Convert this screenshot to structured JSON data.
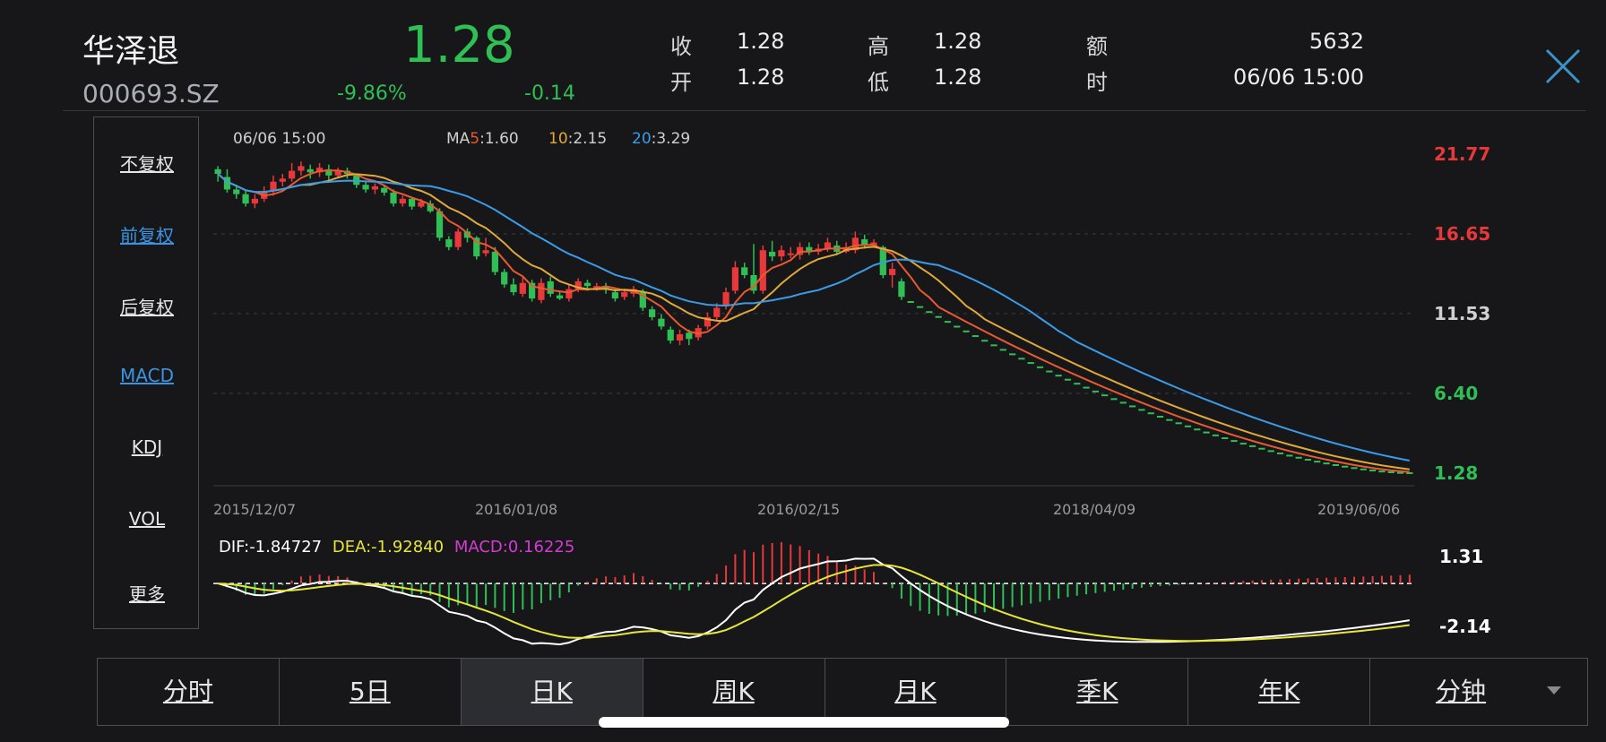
{
  "header": {
    "name": "华泽退",
    "code": "000693.SZ",
    "price": "1.28",
    "pct_change": "-9.86%",
    "abs_change": "-0.14",
    "quotes": [
      {
        "label": "收",
        "value": "1.28"
      },
      {
        "label": "高",
        "value": "1.28"
      },
      {
        "label": "额",
        "value": "5632"
      },
      {
        "label": "开",
        "value": "1.28"
      },
      {
        "label": "低",
        "value": "1.28"
      },
      {
        "label": "时",
        "value": "06/06 15:00"
      }
    ]
  },
  "menu": {
    "items": [
      "不复权",
      "前复权",
      "后复权",
      "MACD",
      "KDJ",
      "VOL",
      "更多"
    ]
  },
  "colors": {
    "up": "#e8393a",
    "down": "#2fbf55",
    "ma5": "#e85a30",
    "ma10": "#e0a93a",
    "ma20": "#3a9be8",
    "dif": "#ffffff",
    "dea": "#e6e63a",
    "macd": "#d43ad4",
    "accent": "#3b94e3"
  },
  "tabs": [
    "分时",
    "5日",
    "日K",
    "周K",
    "月K",
    "季K",
    "年K",
    "分钟"
  ],
  "chart_data": {
    "type": "candlestick",
    "cursor_time": "06/06 15:00",
    "ma_legend": [
      {
        "prefix": "MA",
        "period": "5",
        "value": ":1.60"
      },
      {
        "period": "10",
        "value": ":2.15"
      },
      {
        "period": "20",
        "value": ":3.29"
      }
    ],
    "price_axis_labels": [
      "21.77",
      "16.65",
      "11.53",
      "6.40",
      "1.28"
    ],
    "price_axis_values": [
      21.77,
      16.65,
      11.53,
      6.4,
      1.28
    ],
    "ylim": [
      1.28,
      21.77
    ],
    "date_labels": [
      "2015/12/07",
      "2016/01/08",
      "2016/02/15",
      "2018/04/09",
      "2019/06/06"
    ],
    "candles": [
      [
        20.8,
        20.5,
        21.0,
        20.0
      ],
      [
        20.3,
        19.5,
        20.8,
        19.3
      ],
      [
        19.5,
        19.2,
        19.8,
        18.9
      ],
      [
        19.2,
        18.6,
        19.4,
        18.4
      ],
      [
        18.6,
        18.9,
        19.2,
        18.3
      ],
      [
        18.9,
        19.3,
        19.7,
        18.7
      ],
      [
        19.4,
        20.0,
        20.4,
        19.1
      ],
      [
        20.0,
        20.2,
        20.5,
        19.7
      ],
      [
        20.2,
        20.7,
        21.2,
        20.0
      ],
      [
        20.7,
        21.0,
        21.3,
        20.4
      ],
      [
        20.8,
        20.6,
        21.1,
        20.2
      ],
      [
        20.6,
        20.9,
        21.2,
        20.3
      ],
      [
        20.8,
        20.4,
        21.1,
        20.1
      ],
      [
        20.4,
        20.7,
        20.9,
        20.2
      ],
      [
        20.7,
        20.5,
        20.9,
        20.2
      ],
      [
        20.4,
        19.8,
        20.5,
        19.6
      ],
      [
        19.8,
        19.5,
        20.0,
        19.3
      ],
      [
        19.5,
        19.7,
        19.9,
        19.2
      ],
      [
        19.6,
        19.3,
        19.8,
        19.1
      ],
      [
        19.3,
        18.6,
        19.5,
        18.4
      ],
      [
        18.6,
        18.9,
        19.1,
        18.4
      ],
      [
        18.9,
        18.4,
        19.0,
        18.2
      ],
      [
        18.4,
        18.7,
        18.9,
        18.3
      ],
      [
        18.6,
        18.1,
        18.8,
        18.0
      ],
      [
        18.1,
        16.4,
        18.3,
        16.2
      ],
      [
        16.3,
        15.8,
        16.5,
        15.6
      ],
      [
        15.8,
        16.8,
        17.0,
        15.6
      ],
      [
        16.8,
        16.4,
        17.0,
        16.1
      ],
      [
        16.4,
        15.2,
        16.5,
        15.0
      ],
      [
        15.4,
        15.6,
        16.4,
        15.2
      ],
      [
        15.5,
        14.2,
        15.8,
        14.0
      ],
      [
        14.2,
        13.4,
        14.4,
        13.2
      ],
      [
        13.4,
        12.9,
        13.8,
        12.7
      ],
      [
        12.8,
        13.5,
        13.9,
        12.6
      ],
      [
        13.5,
        12.5,
        13.7,
        12.3
      ],
      [
        12.4,
        13.5,
        13.8,
        12.2
      ],
      [
        13.6,
        12.8,
        13.9,
        12.6
      ],
      [
        12.7,
        12.5,
        13.0,
        12.4
      ],
      [
        12.5,
        13.1,
        13.4,
        12.3
      ],
      [
        13.1,
        13.6,
        13.8,
        12.9
      ],
      [
        13.5,
        13.3,
        13.7,
        13.0
      ],
      [
        13.2,
        13.3,
        13.5,
        13.0
      ],
      [
        13.3,
        13.1,
        13.5,
        12.8
      ],
      [
        12.9,
        12.5,
        13.1,
        12.3
      ],
      [
        12.6,
        12.9,
        13.1,
        12.4
      ],
      [
        12.8,
        13.1,
        13.3,
        12.6
      ],
      [
        12.9,
        11.9,
        13.1,
        11.7
      ],
      [
        11.8,
        11.3,
        12.0,
        11.1
      ],
      [
        11.2,
        10.7,
        11.5,
        10.5
      ],
      [
        10.5,
        9.8,
        10.7,
        9.6
      ],
      [
        9.8,
        10.2,
        10.5,
        9.5
      ],
      [
        10.3,
        9.9,
        10.5,
        9.5
      ],
      [
        10.0,
        10.6,
        10.8,
        9.8
      ],
      [
        10.7,
        11.3,
        11.6,
        10.5
      ],
      [
        11.3,
        11.9,
        12.2,
        11.1
      ],
      [
        12.0,
        12.9,
        13.2,
        11.8
      ],
      [
        13.0,
        14.5,
        14.9,
        12.8
      ],
      [
        14.5,
        14.0,
        14.8,
        13.8
      ],
      [
        14.0,
        13.0,
        16.0,
        12.8
      ],
      [
        13.0,
        15.6,
        15.9,
        12.8
      ],
      [
        15.5,
        15.2,
        16.2,
        14.9
      ],
      [
        15.2,
        15.6,
        15.9,
        14.9
      ],
      [
        15.4,
        15.4,
        15.8,
        15.1
      ],
      [
        15.3,
        15.8,
        16.1,
        15.0
      ],
      [
        15.8,
        15.5,
        16.1,
        15.3
      ],
      [
        15.5,
        15.7,
        16.0,
        15.3
      ],
      [
        15.7,
        16.1,
        16.4,
        15.5
      ],
      [
        15.9,
        15.5,
        16.2,
        15.3
      ],
      [
        15.5,
        15.8,
        16.1,
        15.4
      ],
      [
        15.6,
        16.4,
        16.8,
        15.4
      ],
      [
        16.3,
        15.9,
        16.6,
        15.7
      ],
      [
        15.9,
        16.1,
        16.3,
        15.8
      ],
      [
        15.8,
        14.0,
        15.9,
        13.8
      ],
      [
        14.0,
        14.4,
        14.8,
        13.2
      ],
      [
        13.6,
        12.6,
        13.8,
        12.4
      ]
    ],
    "macd_axis_labels": [
      "1.31",
      "-2.14"
    ],
    "macd_axis_values": [
      1.31,
      -2.14
    ],
    "macd_ylim": [
      -2.3,
      1.45
    ],
    "macd_legend": {
      "dif": "DIF:-1.84727",
      "dea": "DEA:-1.92840",
      "macd": "MACD:0.16225"
    }
  }
}
